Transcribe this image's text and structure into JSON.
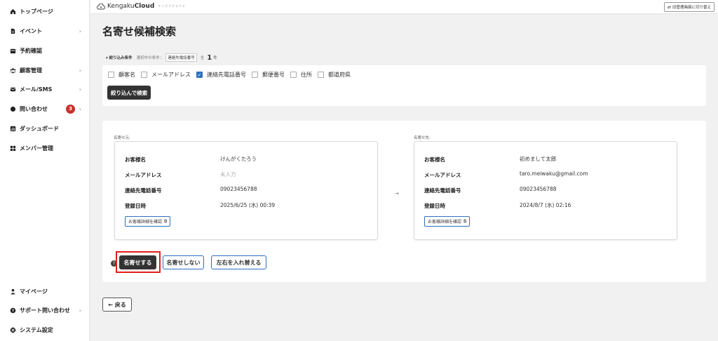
{
  "sidebar": {
    "items": [
      {
        "label": "トップページ",
        "icon": "home-icon"
      },
      {
        "label": "イベント",
        "icon": "document-icon"
      },
      {
        "label": "予約確認",
        "icon": "calendar-icon"
      },
      {
        "label": "顧客管理",
        "icon": "users-icon"
      },
      {
        "label": "メール/SMS",
        "icon": "mail-icon"
      },
      {
        "label": "問い合わせ",
        "icon": "chat-icon",
        "badge": "3"
      },
      {
        "label": "ダッシュボード",
        "icon": "chart-icon"
      },
      {
        "label": "メンバー管理",
        "icon": "grid-icon"
      }
    ],
    "bottom_items": [
      {
        "label": "マイページ",
        "icon": "person-icon"
      },
      {
        "label": "サポート問い合わせ",
        "icon": "help-icon"
      },
      {
        "label": "システム設定",
        "icon": "gear-icon"
      }
    ]
  },
  "header": {
    "brand_prefix": "Kengaku",
    "brand_bold": "Cloud",
    "brand_sub": "ケンガククラウド",
    "switch_label": "旧管理画面に切り替え"
  },
  "page": {
    "title": "名寄せ候補検索"
  },
  "filter": {
    "label": "▾ 絞り込み条件",
    "selected_label": "選択中の条件：",
    "selected_tag": "連絡先電話番号",
    "count_prefix": "全",
    "count": "1",
    "count_unit": "件",
    "options": [
      {
        "label": "顧客名",
        "checked": false
      },
      {
        "label": "メールアドレス",
        "checked": false
      },
      {
        "label": "連絡先電話番号",
        "checked": true
      },
      {
        "label": "郵便番号",
        "checked": false
      },
      {
        "label": "住所",
        "checked": false
      },
      {
        "label": "都道府県",
        "checked": false
      }
    ],
    "search_button": "絞り込んで検索"
  },
  "merge": {
    "source_label": "名寄せ元:",
    "target_label": "名寄せ先:",
    "field_labels": {
      "name": "お客様名",
      "email": "メールアドレス",
      "phone": "連絡先電話番号",
      "registered": "登録日時"
    },
    "source": {
      "name": "けんがくたろう",
      "email": "未入力",
      "phone": "09023456788",
      "registered": "2025/6/25 (水) 00:39"
    },
    "target": {
      "name": "初めまして太郎",
      "email": "taro.meiwaku@gmail.com",
      "phone": "09023456788",
      "registered": "2024/8/7 (水) 02:16"
    },
    "detail_button": "お客様詳細を確認",
    "arrow": "→",
    "merge_button": "名寄せする",
    "no_merge_button": "名寄せしない",
    "swap_button": "左右を入れ替える"
  },
  "back_button": "← 戻る",
  "colors": {
    "accent": "#2f6fbf",
    "dark_button": "#333333",
    "highlight": "#e0201a",
    "badge": "#c9302c"
  }
}
